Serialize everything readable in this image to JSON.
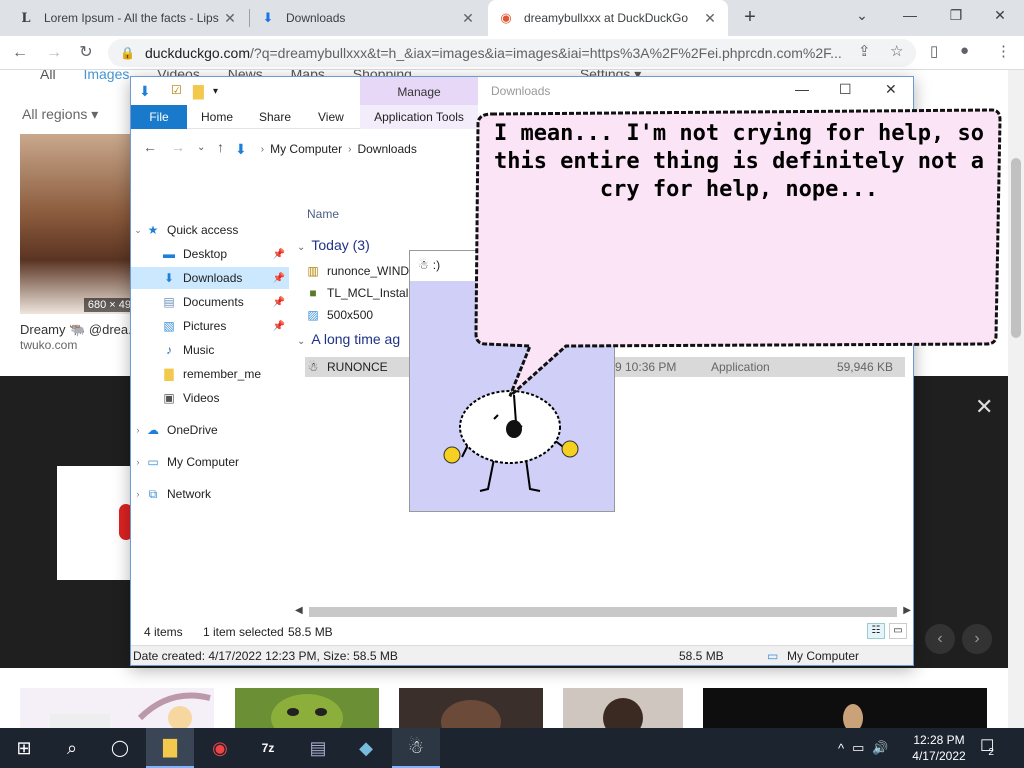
{
  "browser": {
    "tabs": [
      {
        "icon": "L",
        "title": "Lorem Ipsum - All the facts - Lips",
        "close": "✕"
      },
      {
        "icon": "⬇",
        "title": "Downloads",
        "close": "✕"
      },
      {
        "icon": "◉",
        "title": "dreamybullxxx at DuckDuckGo",
        "close": "✕"
      }
    ],
    "new_tab": "+",
    "url_host": "duckduckgo.com",
    "url_rest": "/?q=dreamybullxxx&t=h_&iax=images&ia=images&iai=https%3A%2F%2Fei.phprcdn.com%2F..."
  },
  "ddg": {
    "nav": [
      "All",
      "Images",
      "Videos",
      "News",
      "Maps",
      "Shopping",
      "Settings ▾"
    ],
    "region": "All regions ▾",
    "thumb_dims": "680 × 49",
    "result_title": "Dreamy 🐃 @drea...",
    "result_site": "twuko.com",
    "close": "✕"
  },
  "explorer": {
    "window_title": "Downloads",
    "manage": "Manage",
    "ribbon": {
      "file": "File",
      "home": "Home",
      "share": "Share",
      "view": "View",
      "app_tools": "Application Tools"
    },
    "crumbs": [
      "My Computer",
      "Downloads"
    ],
    "nav": {
      "quick_access": "Quick access",
      "desktop": "Desktop",
      "downloads": "Downloads",
      "documents": "Documents",
      "pictures": "Pictures",
      "music": "Music",
      "remember_me": "remember_me",
      "videos": "Videos",
      "onedrive": "OneDrive",
      "my_computer": "My Computer",
      "network": "Network"
    },
    "column_name": "Name",
    "group_today": "Today (3)",
    "group_long_ago": "A long time ag",
    "files": {
      "f1": "runonce_WIND",
      "f2": "TL_MCL_Installe",
      "f3": "500x500",
      "f4": "RUNONCE",
      "f4_date": "9 10:36 PM",
      "f4_type": "Application",
      "f4_size": "59,946 KB"
    },
    "status": {
      "items": "4 items",
      "selected": "1 item selected",
      "size": "58.5 MB"
    },
    "details": {
      "created": "Date created: 4/17/2022 12:23 PM, Size: 58.5 MB",
      "size": "58.5 MB",
      "location": "My Computer"
    }
  },
  "popup": {
    "title": ":)"
  },
  "bubble": {
    "text": "I mean... I'm not crying for help, so this entire thing is definitely not a cry for help, nope..."
  },
  "taskbar": {
    "time": "12:28 PM",
    "date": "4/17/2022",
    "notifications": "2"
  }
}
